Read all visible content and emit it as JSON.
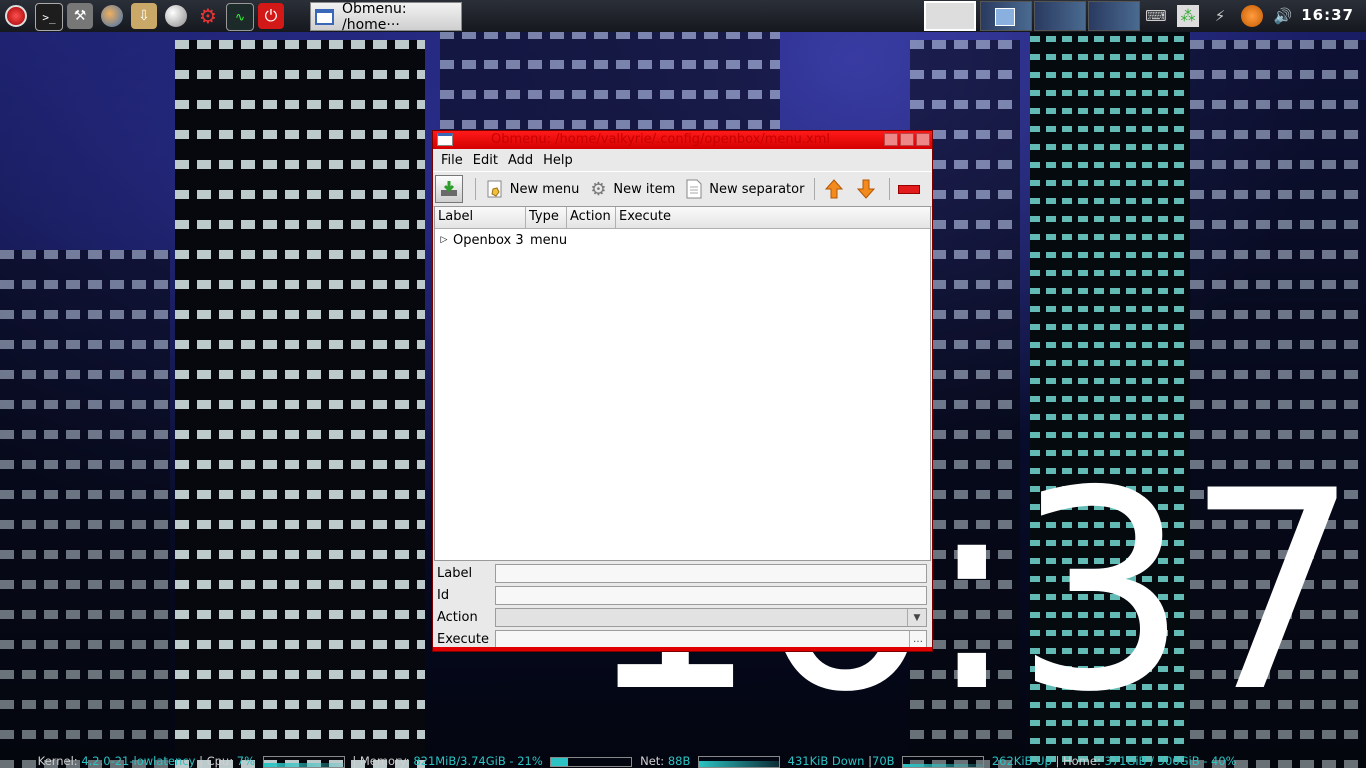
{
  "desktop": {
    "big_clock": "16:37"
  },
  "panel": {
    "task_title": "Obmenu: /home···",
    "clock": "16:37",
    "launchers": [
      "menu-icon",
      "terminal-icon",
      "tools-icon",
      "browser-icon",
      "archive-icon",
      "globe-icon",
      "settings-icon",
      "system-monitor-icon",
      "power-icon"
    ],
    "tray": [
      "keyboard-icon",
      "network-icon",
      "plug-icon",
      "update-icon",
      "volume-icon"
    ]
  },
  "window": {
    "title": "Obmenu: /home/valkyrie/.config/openbox/menu.xml",
    "menubar": [
      "File",
      "Edit",
      "Add",
      "Help"
    ],
    "toolbar": {
      "new_menu": "New menu",
      "new_item": "New item",
      "new_separator": "New separator"
    },
    "columns": [
      "Label",
      "Type",
      "Action",
      "Execute"
    ],
    "rows": [
      {
        "label": "Openbox 3",
        "type": "menu",
        "action": "",
        "execute": ""
      }
    ],
    "form": {
      "label": "Label",
      "id": "Id",
      "action": "Action",
      "execute": "Execute"
    }
  },
  "conky": {
    "kernel_label": "Kernel:",
    "kernel_value": "4.2.0-21-lowlatency",
    "cpu_label": "Cpu:",
    "cpu_value": "7%",
    "memory_label": "Memory:",
    "memory_value": "821MiB/3.74GiB - 21%",
    "memory_percent": 21,
    "net_label": "Net:",
    "net_value": "88B",
    "down_value": "431KiB Down",
    "down_rate": "70B",
    "up_value": "262KiB Up",
    "home_label": "Home:",
    "home_value": "371GiB / 906GiB - 40%"
  }
}
